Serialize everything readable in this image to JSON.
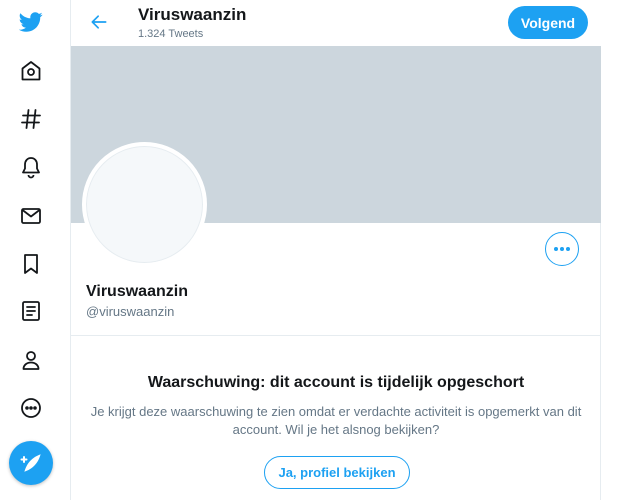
{
  "colors": {
    "accent": "#1da1f2",
    "banner": "#ccd6dd",
    "text_primary": "#14171a",
    "text_secondary": "#657786",
    "border": "#e6ecf0"
  },
  "sidebar": {
    "items": [
      {
        "icon": "twitter-logo-icon"
      },
      {
        "icon": "home-icon"
      },
      {
        "icon": "hashtag-icon"
      },
      {
        "icon": "bell-icon"
      },
      {
        "icon": "envelope-icon"
      },
      {
        "icon": "bookmark-icon"
      },
      {
        "icon": "list-icon"
      },
      {
        "icon": "profile-icon"
      },
      {
        "icon": "more-circle-icon"
      }
    ],
    "compose_icon": "compose-feather-icon"
  },
  "header": {
    "title": "Viruswaanzin",
    "tweet_count": "1.324 Tweets",
    "follow_label": "Volgend"
  },
  "profile": {
    "name": "Viruswaanzin",
    "handle": "@viruswaanzin"
  },
  "warning": {
    "title": "Waarschuwing: dit account is tijdelijk opgeschort",
    "text": "Je krijgt deze waarschuwing te zien omdat er verdachte activiteit is opgemerkt van dit account. Wil je het alsnog bekijken?",
    "button_label": "Ja, profiel bekijken"
  }
}
